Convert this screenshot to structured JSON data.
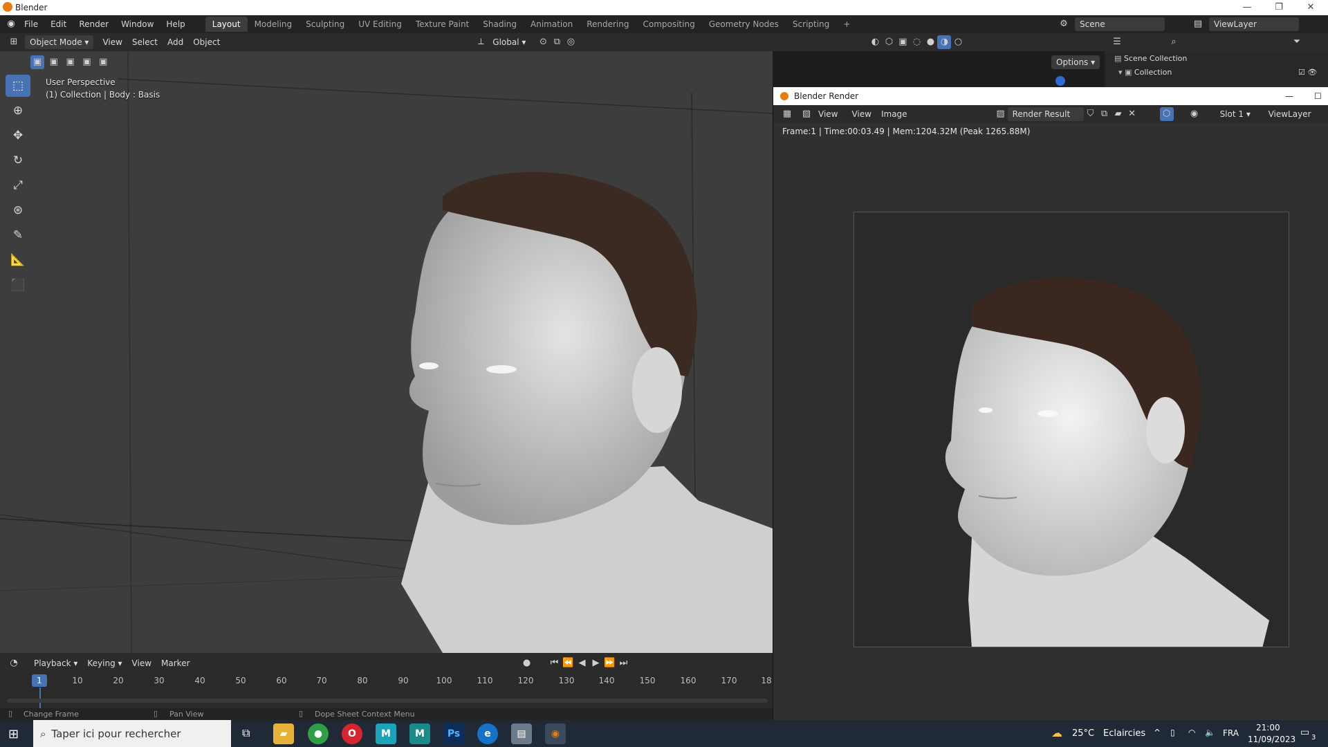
{
  "window": {
    "title": "Blender",
    "minimize": "—",
    "maximize": "❐",
    "close": "✕"
  },
  "menu": {
    "items": [
      "File",
      "Edit",
      "Render",
      "Window",
      "Help"
    ]
  },
  "workspaces": {
    "tabs": [
      "Layout",
      "Modeling",
      "Sculpting",
      "UV Editing",
      "Texture Paint",
      "Shading",
      "Animation",
      "Rendering",
      "Compositing",
      "Geometry Nodes",
      "Scripting"
    ],
    "active": "Layout",
    "add": "+"
  },
  "scene": {
    "scene_label": "Scene",
    "view_layer_label": "ViewLayer"
  },
  "viewport_header": {
    "mode": "Object Mode",
    "menus": [
      "View",
      "Select",
      "Add",
      "Object"
    ],
    "orientation": "Global",
    "options": "Options"
  },
  "viewport": {
    "perspective": "User Perspective",
    "collection_info": "(1) Collection | Body : Basis"
  },
  "outliner": {
    "scene_collection": "Scene Collection",
    "collection": "Collection"
  },
  "render_window": {
    "title": "Blender Render",
    "menus": [
      "View",
      "View",
      "Image"
    ],
    "image_name": "Render Result",
    "slot": "Slot 1",
    "view_layer": "ViewLayer",
    "stats": "Frame:1 | Time:00:03.49 | Mem:1204.32M (Peak 1265.88M)"
  },
  "timeline": {
    "menus": [
      "Playback",
      "Keying",
      "View",
      "Marker"
    ],
    "current_frame": "1",
    "ticks": [
      "10",
      "20",
      "30",
      "40",
      "50",
      "60",
      "70",
      "80",
      "90",
      "100",
      "110",
      "120",
      "130",
      "140",
      "150",
      "160",
      "170",
      "18"
    ]
  },
  "statusbar": {
    "left": "Change Frame",
    "middle": "Pan View",
    "right": "Dope Sheet Context Menu"
  },
  "taskbar": {
    "search_placeholder": "Taper ici pour rechercher",
    "weather_temp": "25°C",
    "weather_text": "Eclaircies",
    "lang": "FRA",
    "time": "21:00",
    "date": "11/09/2023",
    "notifications": "3"
  },
  "colors": {
    "accent": "#4772b3",
    "header": "#2b2b2b",
    "viewport": "#3f3f3f"
  }
}
